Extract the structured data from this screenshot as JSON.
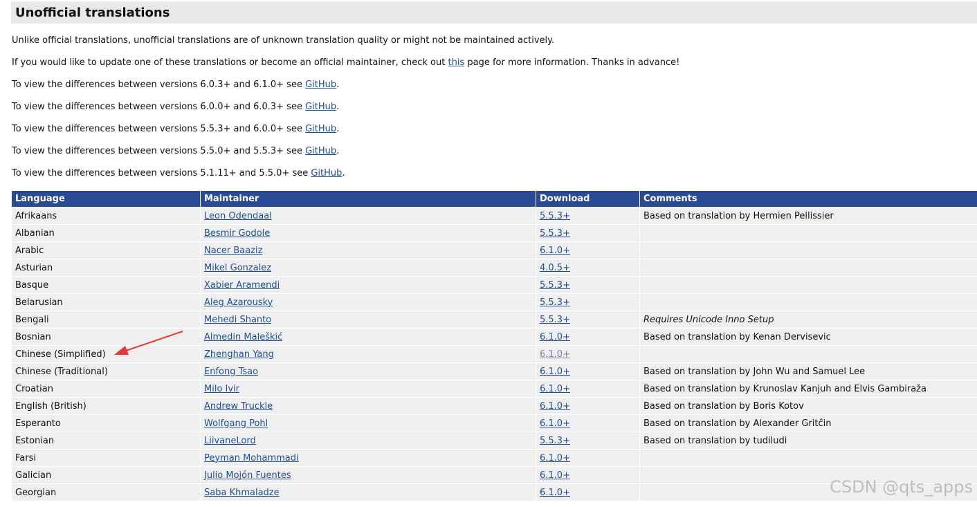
{
  "section": {
    "title": "Unofficial translations"
  },
  "intro": {
    "line1": "Unlike official translations, unofficial translations are of unknown translation quality or might not be maintained actively.",
    "line2_before": "If you would like to update one of these translations or become an official maintainer, check out ",
    "line2_link": "this",
    "line2_after": " page for more information. Thanks in advance!"
  },
  "diffs": [
    {
      "text": "To view the differences between versions 6.0.3+ and 6.1.0+ see ",
      "link": "GitHub",
      "end": "."
    },
    {
      "text": "To view the differences between versions 6.0.0+ and 6.0.3+ see ",
      "link": "GitHub",
      "end": "."
    },
    {
      "text": "To view the differences between versions 5.5.3+ and 6.0.0+ see ",
      "link": "GitHub",
      "end": "."
    },
    {
      "text": "To view the differences between versions 5.5.0+ and 5.5.3+ see ",
      "link": "GitHub",
      "end": "."
    },
    {
      "text": "To view the differences between versions 5.1.11+ and 5.5.0+ see ",
      "link": "GitHub",
      "end": "."
    }
  ],
  "table": {
    "headers": [
      "Language",
      "Maintainer",
      "Download",
      "Comments"
    ],
    "rows": [
      {
        "language": "Afrikaans",
        "maintainer": "Leon Odendaal",
        "download": "5.5.3+",
        "comment": "Based on translation by Hermien Pellissier"
      },
      {
        "language": "Albanian",
        "maintainer": "Besmir Godole",
        "download": "5.5.3+",
        "comment": ""
      },
      {
        "language": "Arabic",
        "maintainer": "Nacer Baaziz",
        "download": "6.1.0+",
        "comment": ""
      },
      {
        "language": "Asturian",
        "maintainer": "Mikel Gonzalez",
        "download": "4.0.5+",
        "comment": ""
      },
      {
        "language": "Basque",
        "maintainer": "Xabier Aramendi",
        "download": "5.5.3+",
        "comment": ""
      },
      {
        "language": "Belarusian",
        "maintainer": "Aleg Azarousky",
        "download": "5.5.3+",
        "comment": ""
      },
      {
        "language": "Bengali",
        "maintainer": "Mehedi Shanto",
        "download": "5.5.3+",
        "comment": "Requires Unicode Inno Setup",
        "italic": true
      },
      {
        "language": "Bosnian",
        "maintainer": "Almedin Maleškić",
        "download": "6.1.0+",
        "comment": "Based on translation by Kenan Dervisevic"
      },
      {
        "language": "Chinese (Simplified)",
        "maintainer": "Zhenghan Yang",
        "download": "6.1.0+",
        "comment": "",
        "visited": true
      },
      {
        "language": "Chinese (Traditional)",
        "maintainer": "Enfong Tsao",
        "download": "6.1.0+",
        "comment": "Based on translation by John Wu and Samuel Lee"
      },
      {
        "language": "Croatian",
        "maintainer": "Milo Ivir",
        "download": "6.1.0+",
        "comment": "Based on translation by Krunoslav Kanjuh and Elvis Gambiraža"
      },
      {
        "language": "English (British)",
        "maintainer": "Andrew Truckle",
        "download": "6.1.0+",
        "comment": "Based on translation by Boris Kotov"
      },
      {
        "language": "Esperanto",
        "maintainer": "Wolfgang Pohl",
        "download": "6.1.0+",
        "comment": "Based on translation by Alexander Gritĉin"
      },
      {
        "language": "Estonian",
        "maintainer": "LiivaneLord",
        "download": "5.5.3+",
        "comment": "Based on translation by tudiludi"
      },
      {
        "language": "Farsi",
        "maintainer": "Peyman Mohammadi",
        "download": "6.1.0+",
        "comment": ""
      },
      {
        "language": "Galician",
        "maintainer": "Julio Mojón Fuentes",
        "download": "6.1.0+",
        "comment": ""
      },
      {
        "language": "Georgian",
        "maintainer": "Saba Khmaladze",
        "download": "6.1.0+",
        "comment": ""
      }
    ]
  },
  "annotation": {
    "arrow_color": "#e53935"
  },
  "watermark": "CSDN @qts_apps"
}
